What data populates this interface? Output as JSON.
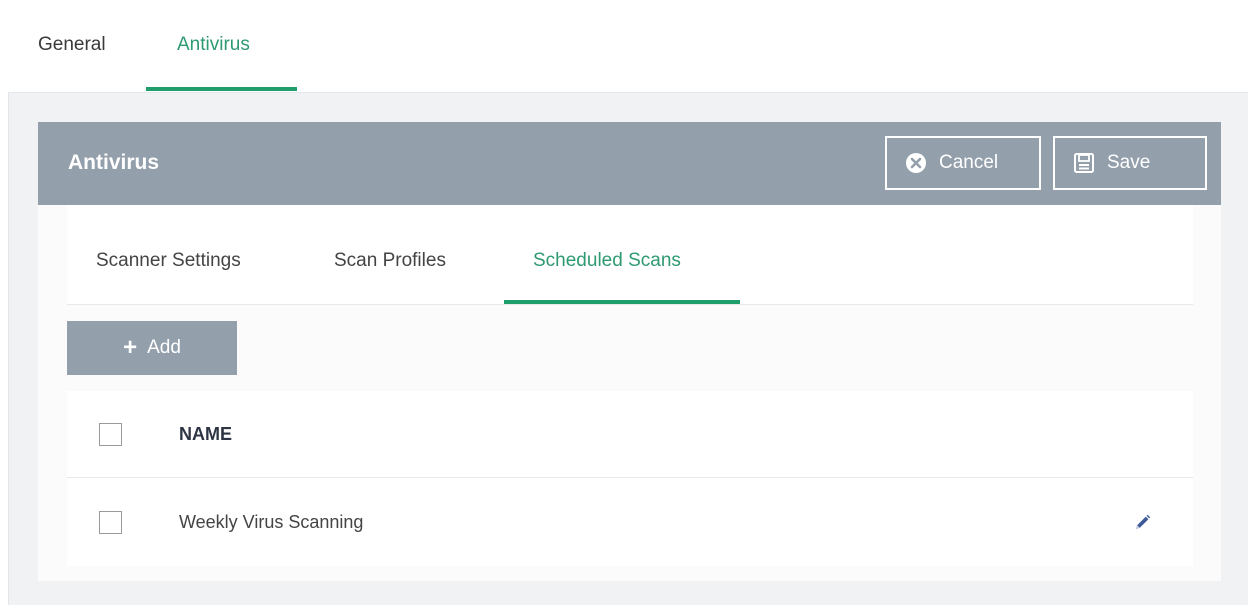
{
  "top_tabs": [
    {
      "label": "General",
      "active": false
    },
    {
      "label": "Antivirus",
      "active": true
    }
  ],
  "panel": {
    "title": "Antivirus",
    "cancel_label": "Cancel",
    "save_label": "Save"
  },
  "sub_tabs": [
    {
      "label": "Scanner Settings",
      "active": false
    },
    {
      "label": "Scan Profiles",
      "active": false
    },
    {
      "label": "Scheduled Scans",
      "active": true
    }
  ],
  "toolbar": {
    "add_label": "Add"
  },
  "table": {
    "columns": [
      "NAME"
    ],
    "rows": [
      {
        "name": "Weekly Virus Scanning"
      }
    ]
  },
  "colors": {
    "accent": "#1f9e6c",
    "header_bg": "#939fab",
    "page_bg": "#f1f2f4"
  },
  "icons": {
    "cancel": "x-circle-icon",
    "save": "floppy-disk-icon",
    "add": "plus-icon",
    "edit": "pencil-icon"
  }
}
